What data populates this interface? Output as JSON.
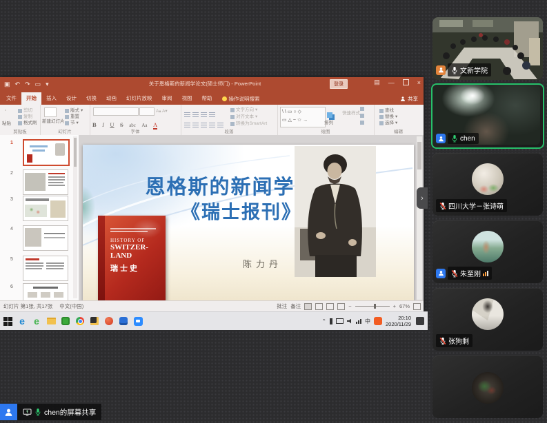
{
  "meeting": {
    "share_badge": {
      "label": "chen的屏幕共享"
    },
    "participants": [
      {
        "name": "文新学院",
        "mic": "on",
        "role_badge": "orange",
        "video": "conference-room"
      },
      {
        "name": "chen",
        "mic": "active",
        "role_badge": "blue",
        "video": "webcam",
        "active_speaker": true
      },
      {
        "name": "四川大学－张诗萌",
        "mic": "muted",
        "avatar": "cat-photo"
      },
      {
        "name": "朱至刚",
        "mic": "muted",
        "role_badge": "blue",
        "network_indicator": true,
        "avatar": "lakeside-photo"
      },
      {
        "name": "张狗剩",
        "mic": "muted",
        "avatar": "portrait-photo"
      },
      {
        "name": "",
        "partial": true
      }
    ],
    "accent_green": "#27c06a",
    "badge_blue": "#2d78f0",
    "badge_orange": "#e2833a"
  },
  "ppt": {
    "window_title": "关于恩格斯的新闻学论文(硕士师门) - PowerPoint",
    "signin": "登录",
    "share": "共享",
    "tabs": [
      "文件",
      "开始",
      "插入",
      "设计",
      "切换",
      "动画",
      "幻灯片放映",
      "审阅",
      "视图",
      "帮助"
    ],
    "active_tab": "开始",
    "tell_me": "操作说明搜索",
    "titlebar_color": "#ad4a30",
    "ribbon": {
      "clipboard": {
        "paste": "粘贴",
        "cut": "剪切",
        "copy": "复制",
        "painter": "格式刷",
        "label": "剪贴板"
      },
      "slides": {
        "new_slide": "新建幻灯片",
        "layout": "版式",
        "reset": "重置",
        "section": "节",
        "label": "幻灯片"
      },
      "font": {
        "bold": "B",
        "italic": "I",
        "underline": "U",
        "strike": "S",
        "abc": "abc",
        "label": "字体"
      },
      "paragraph": {
        "text_dir": "文字方向",
        "align_text": "对齐文本",
        "smartart": "转换为SmartArt",
        "label": "段落"
      },
      "drawing": {
        "arrange": "排列",
        "quick": "快速样式",
        "fill": "形状填充",
        "outline": "形状轮廓",
        "effects": "形状效果",
        "label": "绘图"
      },
      "editing": {
        "find": "查找",
        "replace": "替换",
        "select": "选择",
        "label": "编辑"
      }
    },
    "thumbs": [
      "1",
      "2",
      "3",
      "4",
      "5",
      "6"
    ],
    "status": {
      "slide_info": "幻灯片 第1张, 共17张",
      "language": "中文(中国)",
      "comments": "批注",
      "notes": "备注",
      "zoom": "67%"
    }
  },
  "slide": {
    "title_line1": "恩格斯的新闻学文章",
    "title_line2": "《瑞士报刊》",
    "author": "陈力丹",
    "title_color": "#2c6fb4",
    "book": {
      "eng1": "HISTORY OF",
      "eng2": "SWITZER-",
      "eng3": "LAND",
      "cn": "瑞士史"
    }
  },
  "taskbar": {
    "time": "20:10",
    "date": "2020/11/29"
  }
}
